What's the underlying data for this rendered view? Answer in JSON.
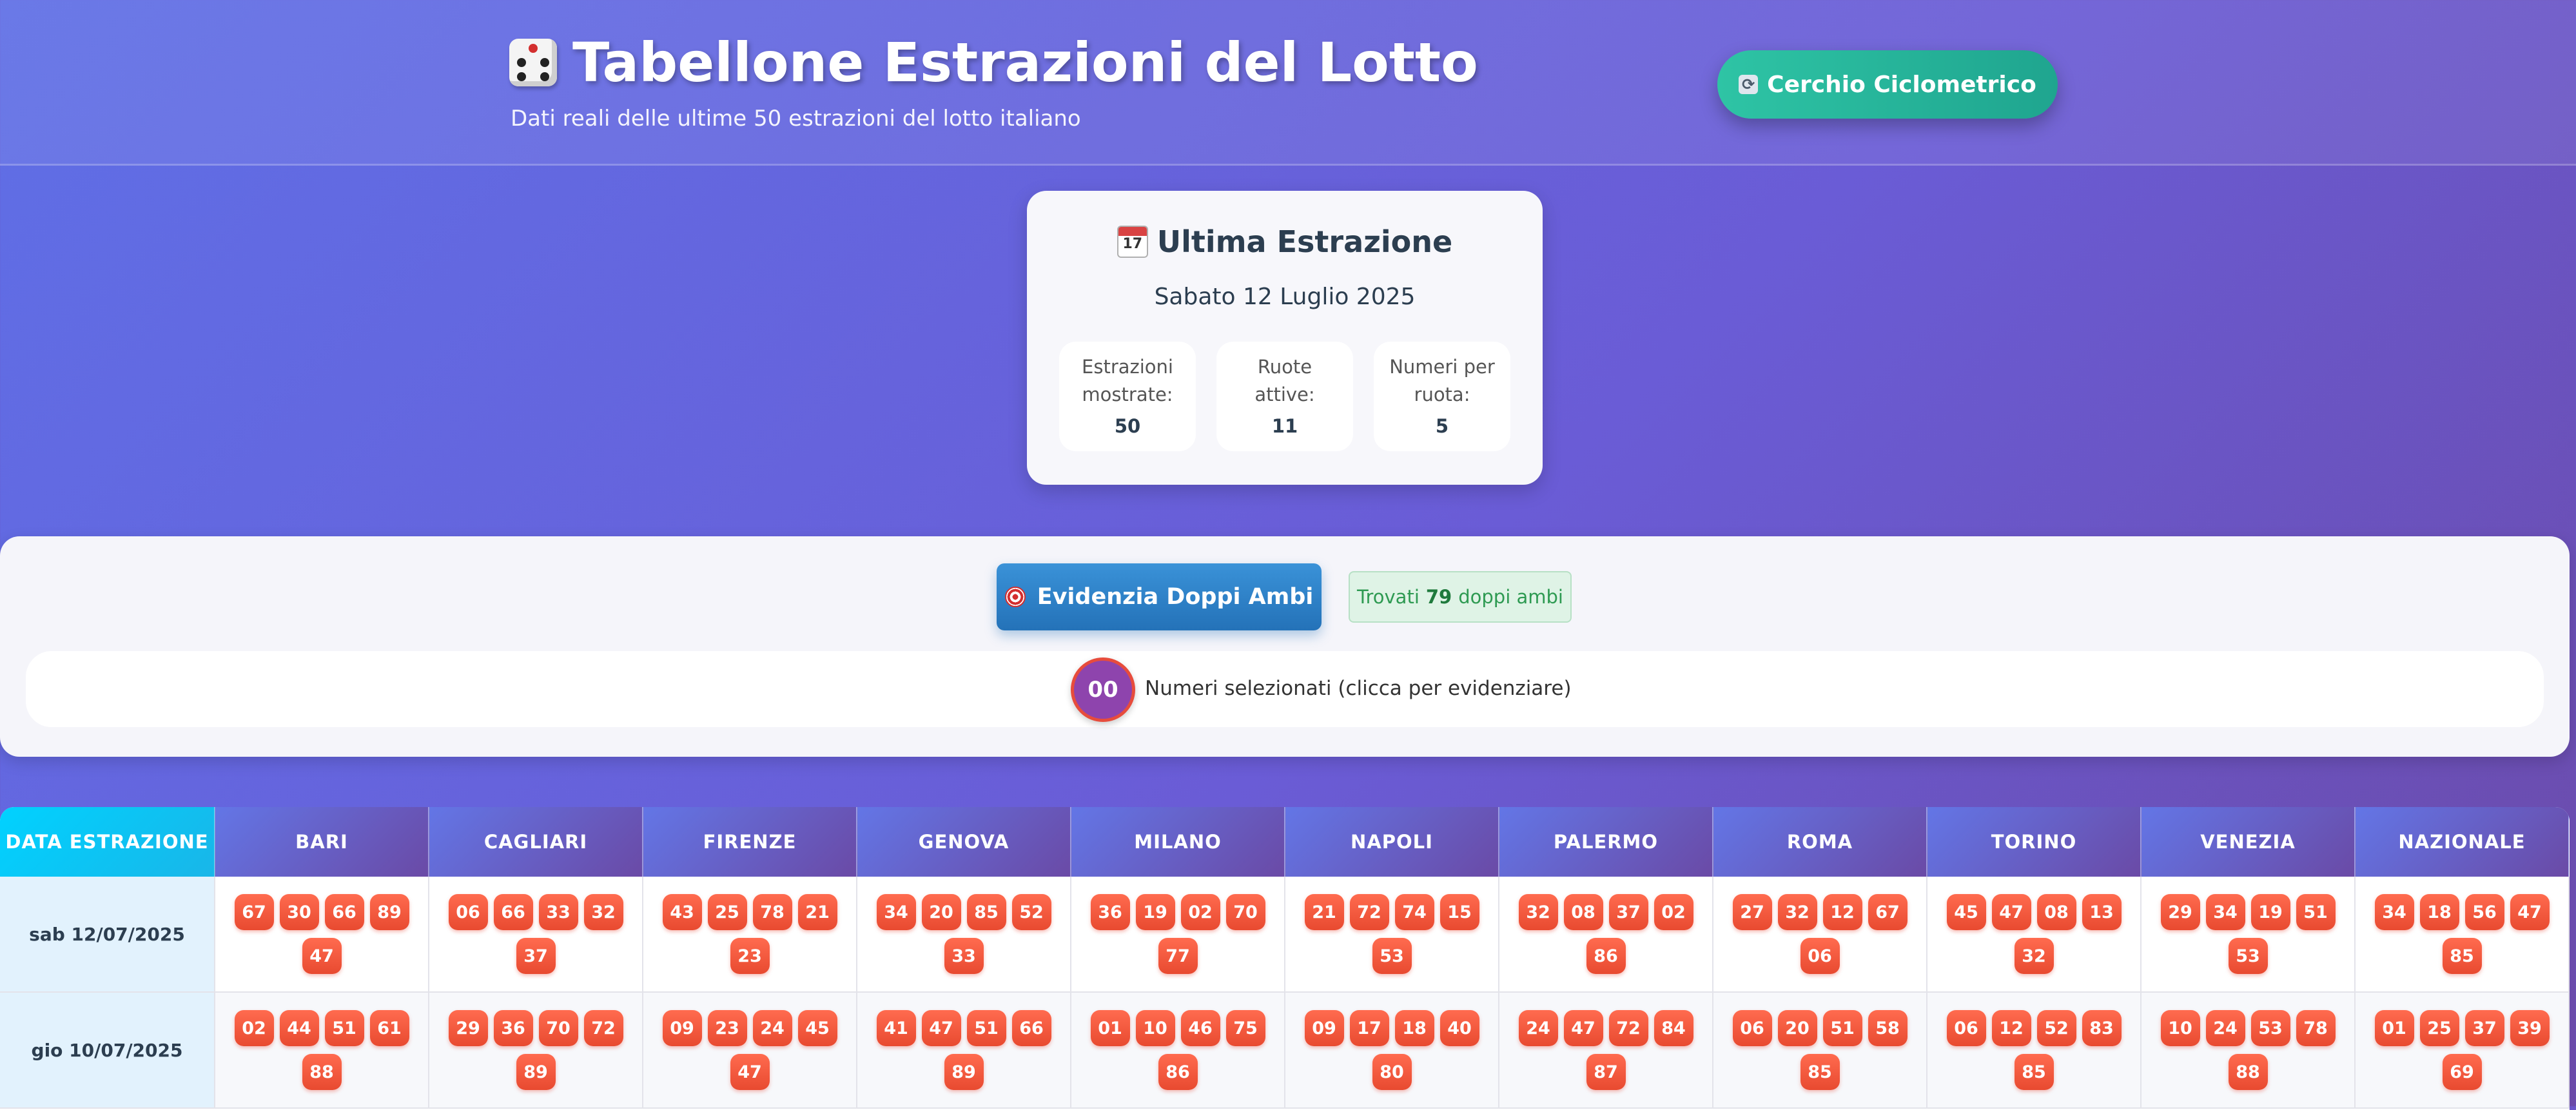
{
  "header": {
    "title": "Tabellone Estrazioni del Lotto",
    "subtitle": "Dati reali delle ultime 50 estrazioni del lotto italiano",
    "cerchio_button": "Cerchio Ciclometrico"
  },
  "last_draw": {
    "title": "Ultima Estrazione",
    "date": "Sabato 12 Luglio 2025",
    "stats": [
      {
        "label": "Estrazioni mostrate:",
        "value": "50"
      },
      {
        "label": "Ruote attive:",
        "value": "11"
      },
      {
        "label": "Numeri per ruota:",
        "value": "5"
      }
    ]
  },
  "controls": {
    "doppi_button": "Evidenzia Doppi Ambi",
    "found_prefix": "Trovati",
    "found_count": "79",
    "found_suffix": "doppi ambi",
    "selected_ball": "00",
    "selected_text": "Numeri selezionati (clicca per evidenziare)"
  },
  "table": {
    "date_header": "DATA ESTRAZIONE",
    "wheels": [
      "BARI",
      "CAGLIARI",
      "FIRENZE",
      "GENOVA",
      "MILANO",
      "NAPOLI",
      "PALERMO",
      "ROMA",
      "TORINO",
      "VENEZIA",
      "NAZIONALE"
    ],
    "rows": [
      {
        "date": "sab 12/07/2025",
        "numbers": [
          [
            "67",
            "30",
            "66",
            "89",
            "47"
          ],
          [
            "06",
            "66",
            "33",
            "32",
            "37"
          ],
          [
            "43",
            "25",
            "78",
            "21",
            "23"
          ],
          [
            "34",
            "20",
            "85",
            "52",
            "33"
          ],
          [
            "36",
            "19",
            "02",
            "70",
            "77"
          ],
          [
            "21",
            "72",
            "74",
            "15",
            "53"
          ],
          [
            "32",
            "08",
            "37",
            "02",
            "86"
          ],
          [
            "27",
            "32",
            "12",
            "67",
            "06"
          ],
          [
            "45",
            "47",
            "08",
            "13",
            "32"
          ],
          [
            "29",
            "34",
            "19",
            "51",
            "53"
          ],
          [
            "34",
            "18",
            "56",
            "47",
            "85"
          ]
        ]
      },
      {
        "date": "gio 10/07/2025",
        "numbers": [
          [
            "02",
            "44",
            "51",
            "61",
            "88"
          ],
          [
            "29",
            "36",
            "70",
            "72",
            "89"
          ],
          [
            "09",
            "23",
            "24",
            "45",
            "47"
          ],
          [
            "41",
            "47",
            "51",
            "66",
            "89"
          ],
          [
            "01",
            "10",
            "46",
            "75",
            "86"
          ],
          [
            "09",
            "17",
            "18",
            "40",
            "80"
          ],
          [
            "24",
            "47",
            "72",
            "84",
            "87"
          ],
          [
            "06",
            "20",
            "51",
            "58",
            "85"
          ],
          [
            "06",
            "12",
            "52",
            "83",
            "85"
          ],
          [
            "10",
            "24",
            "53",
            "78",
            "88"
          ],
          [
            "01",
            "25",
            "37",
            "39",
            "69"
          ]
        ]
      }
    ]
  }
}
